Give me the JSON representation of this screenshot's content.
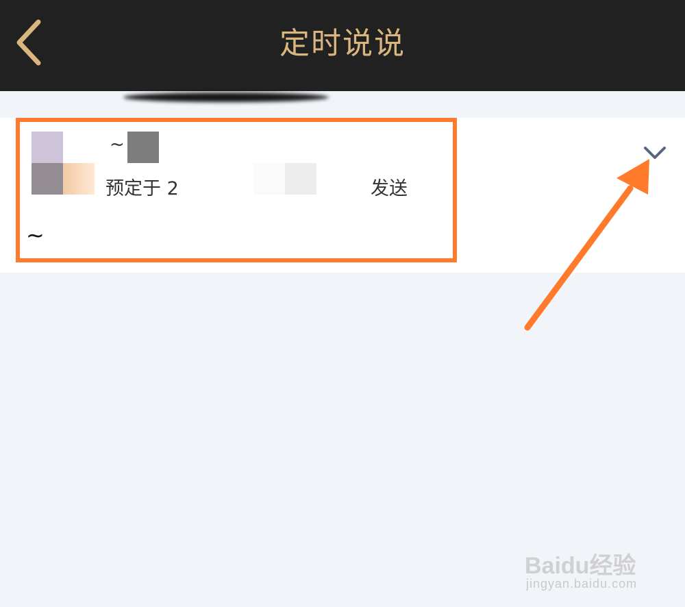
{
  "header": {
    "title": "定时说说",
    "back_icon": "chevron-left-icon",
    "accent_color": "#d9b680",
    "background_color": "#212121"
  },
  "post": {
    "line1_suffix": "~",
    "schedule_prefix": "预定于 2",
    "schedule_suffix": "发送",
    "content": "~",
    "expand_icon": "chevron-down-icon"
  },
  "annotation": {
    "highlight_color": "#ff7a2a",
    "arrow_icon": "arrow-pointer-icon"
  },
  "watermark": {
    "brand": "Baidu经验",
    "url": "jingyan.baidu.com"
  }
}
